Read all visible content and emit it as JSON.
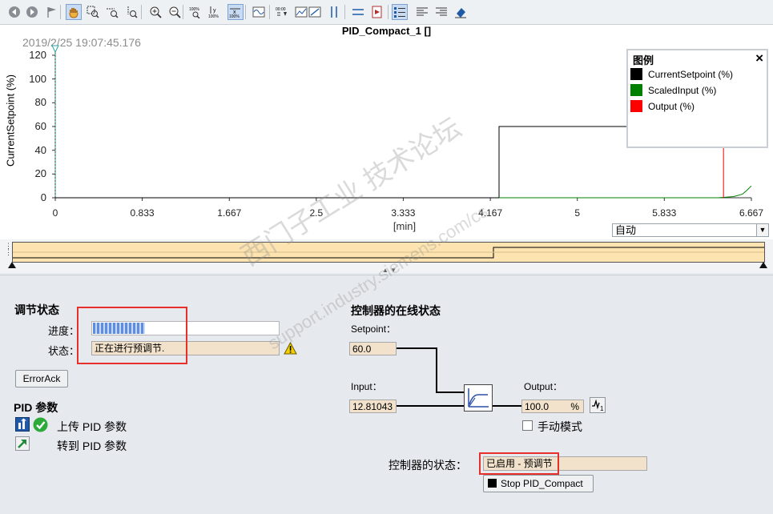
{
  "toolbar": {
    "icons": [
      "back-icon",
      "forward-icon",
      "flag-icon",
      "pan-hand-icon",
      "zoom-rect-icon",
      "zoom-x-icon",
      "zoom-y-icon",
      "zoom-in-icon",
      "zoom-out-icon",
      "zoom-100-icon",
      "y-100-icon",
      "x-100-icon",
      "waveform-icon",
      "insert-value-icon",
      "line-chart-icon",
      "diagonal-icon",
      "vertical-cursors-icon",
      "horizontal-cursors-icon",
      "export-icon",
      "legend-list-icon",
      "align-left-icon",
      "align-right-icon",
      "eraser-icon"
    ]
  },
  "chart": {
    "title": "PID_Compact_1 []",
    "timestamp": "2019/2/25 19:07:45.176",
    "y_axis_label": "CurrentSetpoint (%)",
    "x_unit": "[min]",
    "mode": "自动"
  },
  "legend": {
    "title": "图例",
    "close": "×",
    "items": [
      {
        "label": "CurrentSetpoint (%)",
        "color": "#000000"
      },
      {
        "label": "ScaledInput (%)",
        "color": "#008000"
      },
      {
        "label": "Output (%)",
        "color": "#ff0000"
      }
    ]
  },
  "chart_data": {
    "type": "line",
    "ylabel": "CurrentSetpoint (%)",
    "xlabel": "[min]",
    "x_ticks": [
      "0",
      "0.833",
      "1.667",
      "2.5",
      "3.333",
      "4.167",
      "5",
      "5.833",
      "6.667"
    ],
    "y_ticks": [
      "0",
      "20",
      "40",
      "60",
      "80",
      "100",
      "120"
    ],
    "xlim": [
      0,
      6.667
    ],
    "ylim": [
      0,
      120
    ],
    "series": [
      {
        "name": "CurrentSetpoint (%)",
        "color": "#000000",
        "points": [
          [
            0,
            0
          ],
          [
            4.25,
            0
          ],
          [
            4.25,
            60
          ],
          [
            6.667,
            60
          ]
        ]
      },
      {
        "name": "ScaledInput (%)",
        "color": "#008000",
        "points": [
          [
            4.25,
            0
          ],
          [
            6.35,
            0
          ],
          [
            6.5,
            1
          ],
          [
            6.58,
            3
          ],
          [
            6.62,
            6
          ],
          [
            6.667,
            10
          ]
        ]
      },
      {
        "name": "Output (%)",
        "color": "#ff0000",
        "points": [
          [
            6.4,
            0
          ],
          [
            6.4,
            70
          ]
        ]
      }
    ]
  },
  "tuning": {
    "section_title": "调节状态",
    "progress_label": "进度：",
    "progress_value": 0.28,
    "status_label": "状态：",
    "status_text": "正在进行预调节.",
    "error_ack": "ErrorAck"
  },
  "pid_params": {
    "title": "PID 参数",
    "upload": "上传 PID 参数",
    "goto": "转到 PID 参数"
  },
  "online": {
    "title": "控制器的在线状态",
    "setpoint_label": "Setpoint：",
    "setpoint_value": "60.0",
    "input_label": "Input：",
    "input_value": "12.81043",
    "output_label": "Output：",
    "output_value": "100.0",
    "output_unit": "%",
    "manual_mode": "手动模式",
    "controller_state_label": "控制器的状态：",
    "controller_state_value": "已启用 - 预调节",
    "stop_button": "Stop PID_Compact"
  },
  "watermark": {
    "line1": "西门子工业 技术论坛",
    "line2": "support.industry.siemens.com/cs"
  }
}
